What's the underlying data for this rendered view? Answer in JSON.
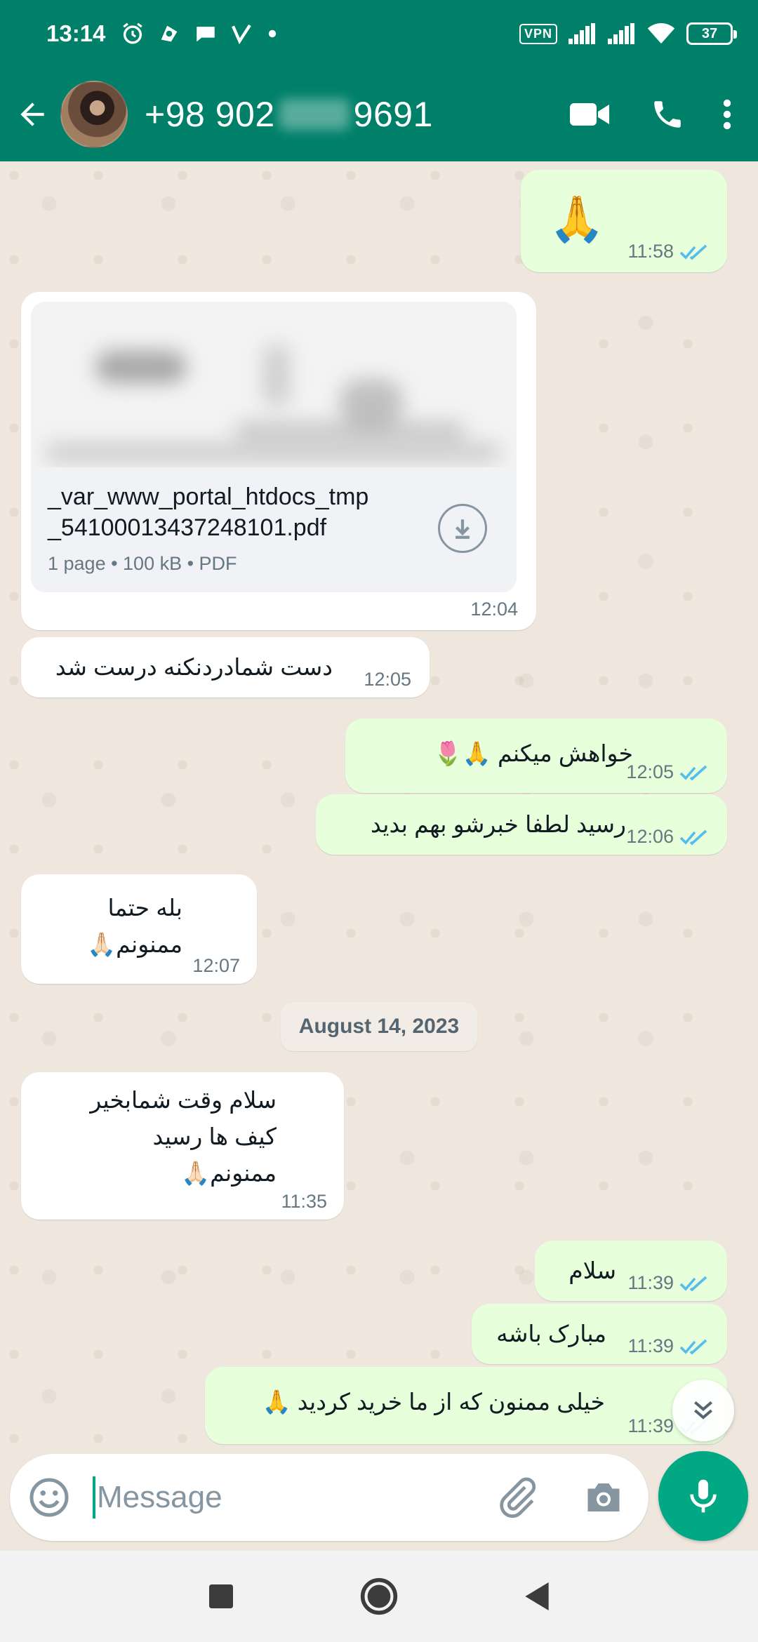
{
  "status_bar": {
    "time": "13:14",
    "vpn": "VPN",
    "battery": "37",
    "icons": [
      "alarm-icon",
      "app-icon",
      "chat-icon",
      "v-icon",
      "dot-icon",
      "signal-icon",
      "signal-icon",
      "wifi-icon"
    ]
  },
  "header": {
    "contact_prefix": "+98 902",
    "contact_suffix": "9691",
    "icons": [
      "back-arrow-icon",
      "video-call-icon",
      "voice-call-icon",
      "more-vert-icon"
    ]
  },
  "messages": [
    {
      "dir": "out",
      "text": "🙏",
      "time": "11:58",
      "read": true
    },
    {
      "dir": "in",
      "type": "document",
      "filename_line1": "_var_www_portal_htdocs_tmp",
      "filename_line2": "_54100013437248101.pdf",
      "details": "1 page • 100 kB • PDF",
      "time": "12:04"
    },
    {
      "dir": "in",
      "text": "دست شمادردنکنه درست شد",
      "time": "12:05"
    },
    {
      "dir": "out",
      "text": "خواهش میکنم 🙏🌷",
      "time": "12:05",
      "read": true
    },
    {
      "dir": "out",
      "text": "رسید لطفا خبرشو بهم بدید",
      "time": "12:06",
      "read": true
    },
    {
      "dir": "in",
      "line1": "بله حتما",
      "line2": "ممنونم🙏🏻",
      "time": "12:07"
    },
    {
      "dir": "in",
      "line1": "سلام وقت شمابخیر",
      "line2": "کیف ها رسید",
      "line3": "ممنونم🙏🏻",
      "time": "11:35"
    },
    {
      "dir": "out",
      "text": "سلام",
      "time": "11:39",
      "read": true
    },
    {
      "dir": "out",
      "text": "مبارک باشه",
      "time": "11:39",
      "read": true
    },
    {
      "dir": "out",
      "text": "خیلی ممنون که از ما خرید کردید 🙏",
      "time": "11:39",
      "read": true
    }
  ],
  "date_divider": "August 14, 2023",
  "composer": {
    "placeholder": "Message",
    "icons": [
      "emoji-icon",
      "attach-icon",
      "camera-icon",
      "mic-icon"
    ]
  },
  "colors": {
    "header": "#008069",
    "outgoing_bubble": "#e7ffdb",
    "incoming_bubble": "#ffffff",
    "accent": "#00a884",
    "read_ticks": "#53bdeb"
  }
}
